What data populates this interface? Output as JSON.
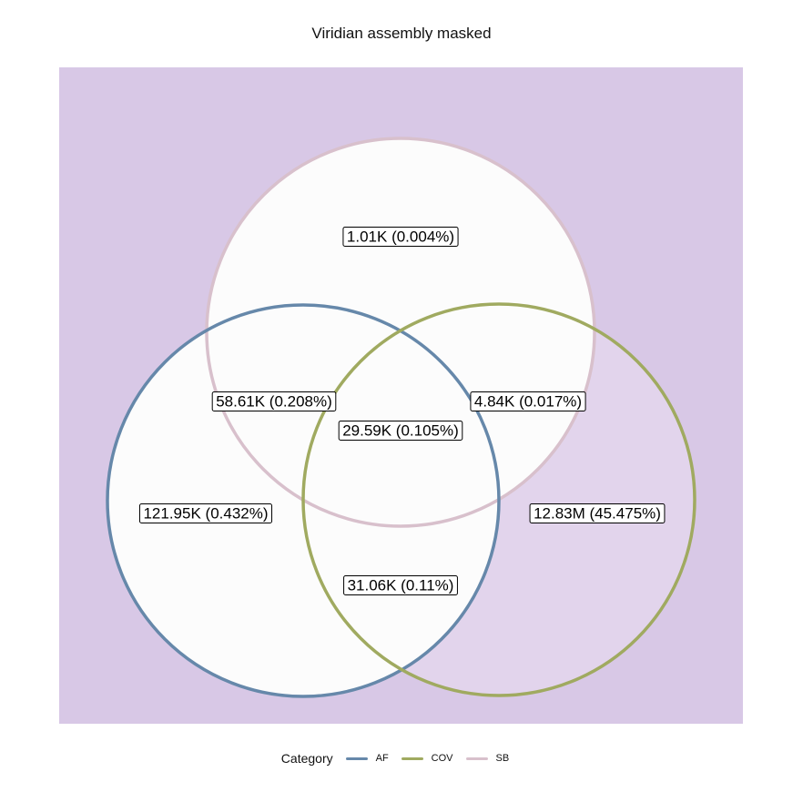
{
  "chart_data": {
    "type": "venn",
    "title": "Viridian assembly masked",
    "sets": [
      {
        "name": "AF",
        "color": "#6688AA"
      },
      {
        "name": "COV",
        "color": "#A0AA60"
      },
      {
        "name": "SB",
        "color": "#D8C0CC"
      }
    ],
    "regions": [
      {
        "sets": [
          "SB"
        ],
        "label": "1.01K (0.004%)",
        "count": 1010,
        "percent": 0.004
      },
      {
        "sets": [
          "AF",
          "SB"
        ],
        "label": "58.61K (0.208%)",
        "count": 58610,
        "percent": 0.208
      },
      {
        "sets": [
          "COV",
          "SB"
        ],
        "label": "4.84K (0.017%)",
        "count": 4840,
        "percent": 0.017
      },
      {
        "sets": [
          "AF",
          "COV",
          "SB"
        ],
        "label": "29.59K (0.105%)",
        "count": 29590,
        "percent": 0.105
      },
      {
        "sets": [
          "AF"
        ],
        "label": "121.95K (0.432%)",
        "count": 121950,
        "percent": 0.432
      },
      {
        "sets": [
          "COV"
        ],
        "label": "12.83M (45.475%)",
        "count": 12830000,
        "percent": 45.475
      },
      {
        "sets": [
          "AF",
          "COV"
        ],
        "label": "31.06K (0.11%)",
        "count": 31060,
        "percent": 0.11
      }
    ],
    "legend": {
      "title": "Category",
      "position": "bottom",
      "items": [
        "AF",
        "COV",
        "SB"
      ]
    },
    "colors": {
      "panel_background": "#D8C8E6",
      "region_fill_low": "#FCFCFC",
      "region_fill_high": "#E2D4EC"
    }
  }
}
